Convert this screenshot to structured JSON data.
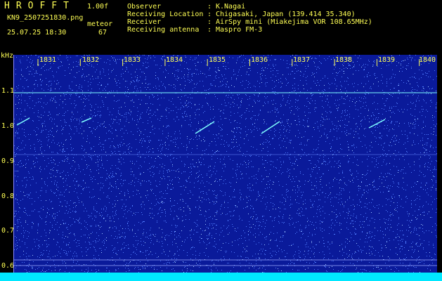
{
  "header": {
    "app_title": "HROFFT",
    "version": "1.00f",
    "filename": "KN9_2507251830.png",
    "meteor_label": "meteor",
    "datetime": "25.07.25 18:30",
    "meteor_count": "67"
  },
  "info": [
    {
      "key": "Observer",
      "value": "K.Nagai"
    },
    {
      "key": "Receiving Location",
      "value": "Chigasaki, Japan (139.414 35.340)"
    },
    {
      "key": "Receiver",
      "value": "AirSpy mini (Miakejima VOR 108.65MHz)"
    },
    {
      "key": "Receiving antenna",
      "value": "Maspro FM-3"
    }
  ],
  "spectrogram": {
    "unit_label": "kHz",
    "y_labels": [
      "1.1",
      "1.0",
      "0.9",
      "0.8",
      "0.7",
      "0.6"
    ],
    "x_labels": [
      "1831",
      "1832",
      "1833",
      "1834",
      "1835",
      "1836",
      "1837",
      "1838",
      "1839",
      "1840"
    ],
    "colors": {
      "background": "#0a1a9a",
      "noise": "#4f7cff",
      "signal": "#7fffff",
      "strip": "#00e8ff",
      "text": "#ffff55"
    }
  }
}
